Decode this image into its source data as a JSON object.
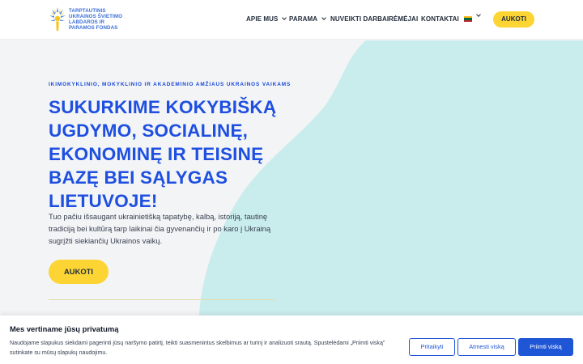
{
  "header": {
    "logo_lines": [
      "TARPTAUTINIS",
      "UKRAINOS ŠVIETIMO",
      "LABDAROS IR",
      "PARAMOS FONDAS"
    ],
    "nav": [
      {
        "label": "APIE MUS",
        "has_dropdown": true
      },
      {
        "label": "PARAMA",
        "has_dropdown": true
      },
      {
        "label": "NUVEIKTI DARBAI",
        "has_dropdown": false
      },
      {
        "label": "RĖMĖJAI",
        "has_dropdown": false
      },
      {
        "label": "KONTAKTAI",
        "has_dropdown": false
      }
    ],
    "language_flag": "lithuania-flag-icon",
    "donate_label": "AUKOTI"
  },
  "hero": {
    "eyebrow": "IKIMOKYKLINIO, MOKYKLINIO IR AKADEMINIO AMŽIAUS UKRAINOS VAIKAMS",
    "title_lines": [
      "SUKURKIME KOKYBIŠKĄ",
      "UGDYMO, SOCIALINĘ,",
      "EKONOMINĘ IR TEISINĘ",
      "BAZĘ BEI SĄLYGAS",
      "LIETUVOJE!"
    ],
    "text_lines": [
      "Tuo pačiu išsaugant ukrainietišką tapatybę, kalbą, istoriją, tautinę",
      "tradiciją bei kultūrą tarp laikinai čia gyvenančių ir po karo į Ukrainą",
      "sugrįžti siekiančių Ukrainos vaikų."
    ],
    "button_label": "AUKOTI"
  },
  "cookie": {
    "title": "Mes vertiname jūsų privatumą",
    "text_lines": [
      "Naudojame slapukus siekdami pagerinti jūsų naršymo patirtį, teikti suasmenintus skelbimus ar turinį ir analizuoti srautą. Spustelėdami „Priimti viską\"",
      "sutinkate su mūsų slapukų naudojimu."
    ],
    "customize_label": "Pritaikyti",
    "reject_label": "Atmesti viską",
    "accept_label": "Priimti viską"
  },
  "colors": {
    "accent_blue": "#1e4fe0",
    "button_yellow": "#fcd535",
    "blob_teal": "#c8ecec",
    "background": "#f3f4f6"
  }
}
